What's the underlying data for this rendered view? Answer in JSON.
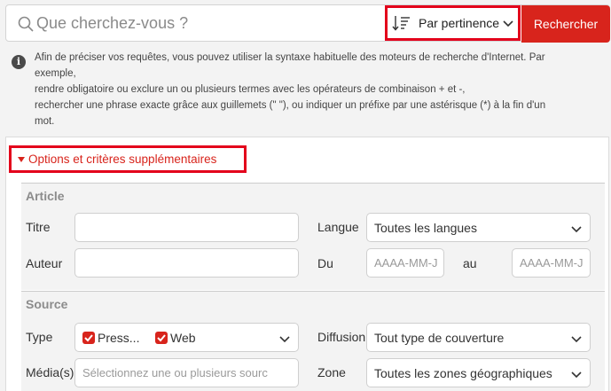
{
  "search": {
    "placeholder": "Que cherchez-vous ?",
    "sort_label": "Par pertinence",
    "button_label": "Rechercher"
  },
  "help": {
    "lines": [
      "Afin de préciser vos requêtes, vous pouvez utiliser la syntaxe habituelle des moteurs de recherche d'Internet. Par",
      "exemple,",
      "rendre obligatoire ou exclure un ou plusieurs termes avec les opérateurs de combinaison + et -,",
      "rechercher une phrase exacte grâce aux guillemets (\" \"), ou indiquer un préfixe par une astérisque (*) à la fin d'un",
      "mot."
    ]
  },
  "options": {
    "toggle_label": "Options et critères supplémentaires",
    "accent_color": "#d8241c",
    "highlight_color": "#e3001b",
    "article": {
      "title": "Article",
      "titre_label": "Titre",
      "auteur_label": "Auteur",
      "langue_label": "Langue",
      "langue_value": "Toutes les langues",
      "du_label": "Du",
      "au_label": "au",
      "date_from_placeholder": "AAAA-MM-J",
      "date_to_placeholder": "AAAA-MM-J"
    },
    "source": {
      "title": "Source",
      "type_label": "Type",
      "type_chips": [
        "Press...",
        "Web"
      ],
      "diffusion_label": "Diffusion",
      "diffusion_value": "Tout type de couverture",
      "medias_label": "Média(s)",
      "medias_placeholder": "Sélectionnez une ou plusieurs sourc",
      "zone_label": "Zone",
      "zone_value": "Toutes les zones géographiques"
    }
  }
}
